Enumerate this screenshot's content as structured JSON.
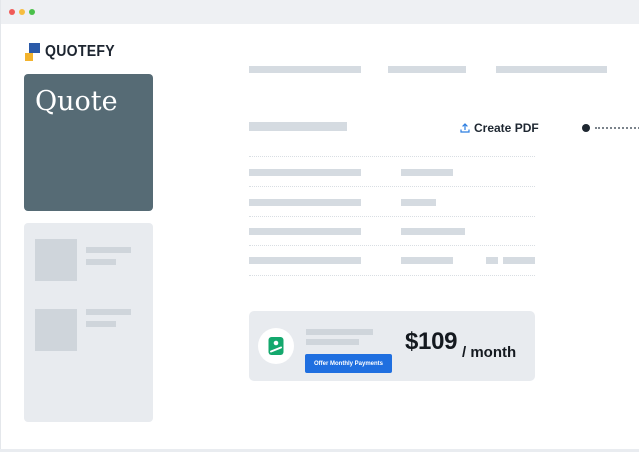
{
  "window": {
    "traffic_lights": [
      {
        "name": "close",
        "color": "#f05a57"
      },
      {
        "name": "minimize",
        "color": "#f6bd3f"
      },
      {
        "name": "zoom",
        "color": "#4ac04a"
      }
    ]
  },
  "brand": {
    "name": "QUOTEFY",
    "colors": {
      "blue": "#2b5aa8",
      "yellow": "#f3b32d"
    }
  },
  "sidebar": {
    "quote_card_title": "Quote",
    "quote_card_color": "#566b75"
  },
  "toolbar": {
    "create_pdf_label": "Create PDF",
    "create_pdf_icon": "upload-icon"
  },
  "payment": {
    "icon": "money-icon",
    "offer_button_label": "Offer Monthly Payments",
    "price": "$109",
    "period": "/ month",
    "accent_color": "#1f6fe0",
    "icon_color": "#14a86d"
  }
}
